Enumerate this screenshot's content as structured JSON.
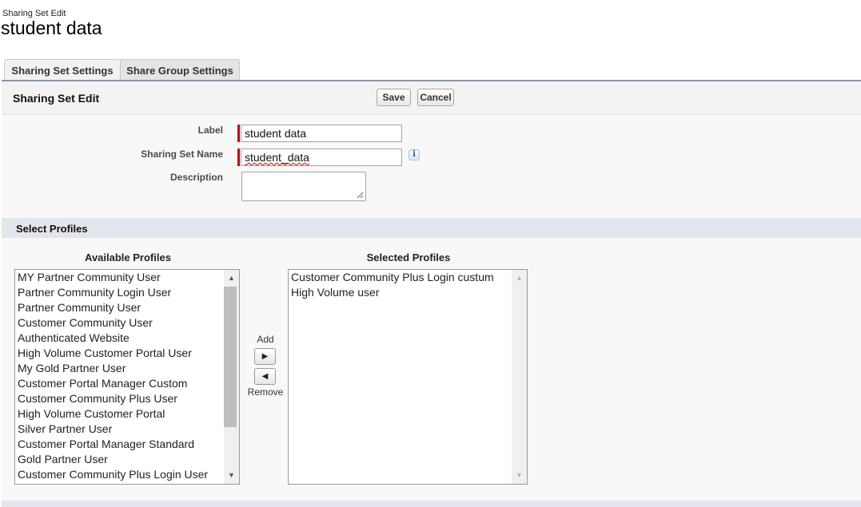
{
  "header": {
    "subtitle": "Sharing Set Edit",
    "title": "student data"
  },
  "tabs": [
    {
      "label": "Sharing Set Settings",
      "active": true
    },
    {
      "label": "Share Group Settings",
      "active": false
    }
  ],
  "edit_section": {
    "title": "Sharing Set Edit",
    "save_label": "Save",
    "cancel_label": "Cancel"
  },
  "form": {
    "label_field": {
      "label": "Label",
      "value": "student data",
      "required": true
    },
    "name_field": {
      "label": "Sharing Set Name",
      "value": "student_data",
      "required": true
    },
    "description_field": {
      "label": "Description",
      "value": ""
    },
    "info_icon": "info-icon"
  },
  "profiles": {
    "section_title": "Select Profiles",
    "available_title": "Available Profiles",
    "selected_title": "Selected Profiles",
    "add_label": "Add",
    "remove_label": "Remove",
    "available": [
      "MY Partner Community User",
      "Partner Community Login User",
      "Partner Community User",
      "Customer Community User",
      "Authenticated Website",
      "High Volume Customer Portal User",
      "My Gold Partner User",
      "Customer Portal Manager Custom",
      "Customer Community Plus User",
      "High Volume Customer Portal",
      "Silver Partner User",
      "Customer Portal Manager Standard",
      "Gold Partner User",
      "Customer Community Plus Login User"
    ],
    "selected": [
      "Customer Community Plus Login custum",
      "High Volume user"
    ]
  },
  "colors": {
    "required": "#c00000",
    "tab_underline": "#8a96a8",
    "section_band": "#e3e6ec"
  }
}
